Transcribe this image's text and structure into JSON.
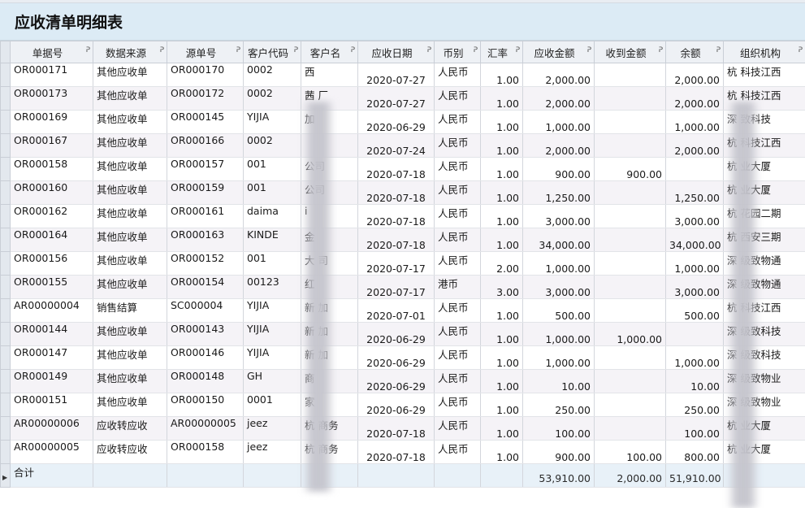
{
  "title": "应收清单明细表",
  "columns": [
    {
      "label": "单据号",
      "align": "txt"
    },
    {
      "label": "数据来源",
      "align": "txt"
    },
    {
      "label": "源单号",
      "align": "txt"
    },
    {
      "label": "客户代码",
      "align": "txt"
    },
    {
      "label": "客户名",
      "align": "txt"
    },
    {
      "label": "应收日期",
      "align": "ctr"
    },
    {
      "label": "币别",
      "align": "txt"
    },
    {
      "label": "汇率",
      "align": "num"
    },
    {
      "label": "应收金额",
      "align": "num"
    },
    {
      "label": "收到金额",
      "align": "num"
    },
    {
      "label": "余额",
      "align": "num"
    },
    {
      "label": "组织机构",
      "align": "txt"
    }
  ],
  "rows": [
    [
      "OR000171",
      "其他应收单",
      "OR000170",
      "0002",
      "西",
      "2020-07-27",
      "人民币",
      "1.00",
      "2,000.00",
      "",
      "2,000.00",
      "杭 科技江西"
    ],
    [
      "OR000173",
      "其他应收单",
      "OR000172",
      "0002",
      "茜 厂",
      "2020-07-27",
      "人民币",
      "1.00",
      "2,000.00",
      "",
      "2,000.00",
      "杭 科技江西"
    ],
    [
      "OR000169",
      "其他应收单",
      "OR000145",
      "YIJIA",
      "加",
      "2020-06-29",
      "人民币",
      "1.00",
      "1,000.00",
      "",
      "1,000.00",
      "深 致科技"
    ],
    [
      "OR000167",
      "其他应收单",
      "OR000166",
      "0002",
      "",
      "2020-07-24",
      "人民币",
      "1.00",
      "2,000.00",
      "",
      "2,000.00",
      "杭 科技江西"
    ],
    [
      "OR000158",
      "其他应收单",
      "OR000157",
      "001",
      "公司",
      "2020-07-18",
      "人民币",
      "1.00",
      "900.00",
      "900.00",
      "",
      "杭 业大厦"
    ],
    [
      "OR000160",
      "其他应收单",
      "OR000159",
      "001",
      "公司",
      "2020-07-18",
      "人民币",
      "1.00",
      "1,250.00",
      "",
      "1,250.00",
      "杭 业大厦"
    ],
    [
      "OR000162",
      "其他应收单",
      "OR000161",
      "daima",
      "i",
      "2020-07-18",
      "人民币",
      "1.00",
      "3,000.00",
      "",
      "3,000.00",
      "杭 花园二期"
    ],
    [
      "OR000164",
      "其他应收单",
      "OR000163",
      "KINDE",
      "金",
      "2020-07-18",
      "人民币",
      "1.00",
      "34,000.00",
      "",
      "34,000.00",
      "杭 西安三期"
    ],
    [
      "OR000156",
      "其他应收单",
      "OR000152",
      "001",
      "大 司",
      "2020-07-17",
      "人民币",
      "2.00",
      "1,000.00",
      "",
      "1,000.00",
      "深 级致物通"
    ],
    [
      "OR000155",
      "其他应收单",
      "OR000154",
      "00123",
      "红",
      "2020-07-17",
      "港币",
      "3.00",
      "3,000.00",
      "",
      "3,000.00",
      "深 级致物通"
    ],
    [
      "AR00000004",
      "销售结算",
      "SC000004",
      "YIJIA",
      "新 加",
      "2020-07-01",
      "人民币",
      "1.00",
      "500.00",
      "",
      "500.00",
      "杭 科技江西"
    ],
    [
      "OR000144",
      "其他应收单",
      "OR000143",
      "YIJIA",
      "新 加",
      "2020-06-29",
      "人民币",
      "1.00",
      "1,000.00",
      "1,000.00",
      "",
      "深 级致科技"
    ],
    [
      "OR000147",
      "其他应收单",
      "OR000146",
      "YIJIA",
      "新 加",
      "2020-06-29",
      "人民币",
      "1.00",
      "1,000.00",
      "",
      "1,000.00",
      "深 级致科技"
    ],
    [
      "OR000149",
      "其他应收单",
      "OR000148",
      "GH",
      "商",
      "2020-06-29",
      "人民币",
      "1.00",
      "10.00",
      "",
      "10.00",
      "深 级致物业"
    ],
    [
      "OR000151",
      "其他应收单",
      "OR000150",
      "0001",
      "家",
      "2020-06-29",
      "人民币",
      "1.00",
      "250.00",
      "",
      "250.00",
      "深 级致物业"
    ],
    [
      "AR00000006",
      "应收转应收",
      "AR00000005",
      "jeez",
      "杭 商务",
      "2020-07-18",
      "人民币",
      "1.00",
      "100.00",
      "",
      "100.00",
      "杭 业大厦"
    ],
    [
      "AR00000005",
      "应收转应收",
      "OR000158",
      "jeez",
      "杭 商务",
      "2020-07-18",
      "人民币",
      "1.00",
      "900.00",
      "100.00",
      "800.00",
      "杭 业大厦"
    ]
  ],
  "footer": {
    "label": "合计",
    "total_receivable": "53,910.00",
    "total_received": "2,000.00",
    "total_balance": "51,910.00"
  },
  "icons": {
    "pin": "pin-icon",
    "row_pointer": "row-pointer-icon"
  }
}
